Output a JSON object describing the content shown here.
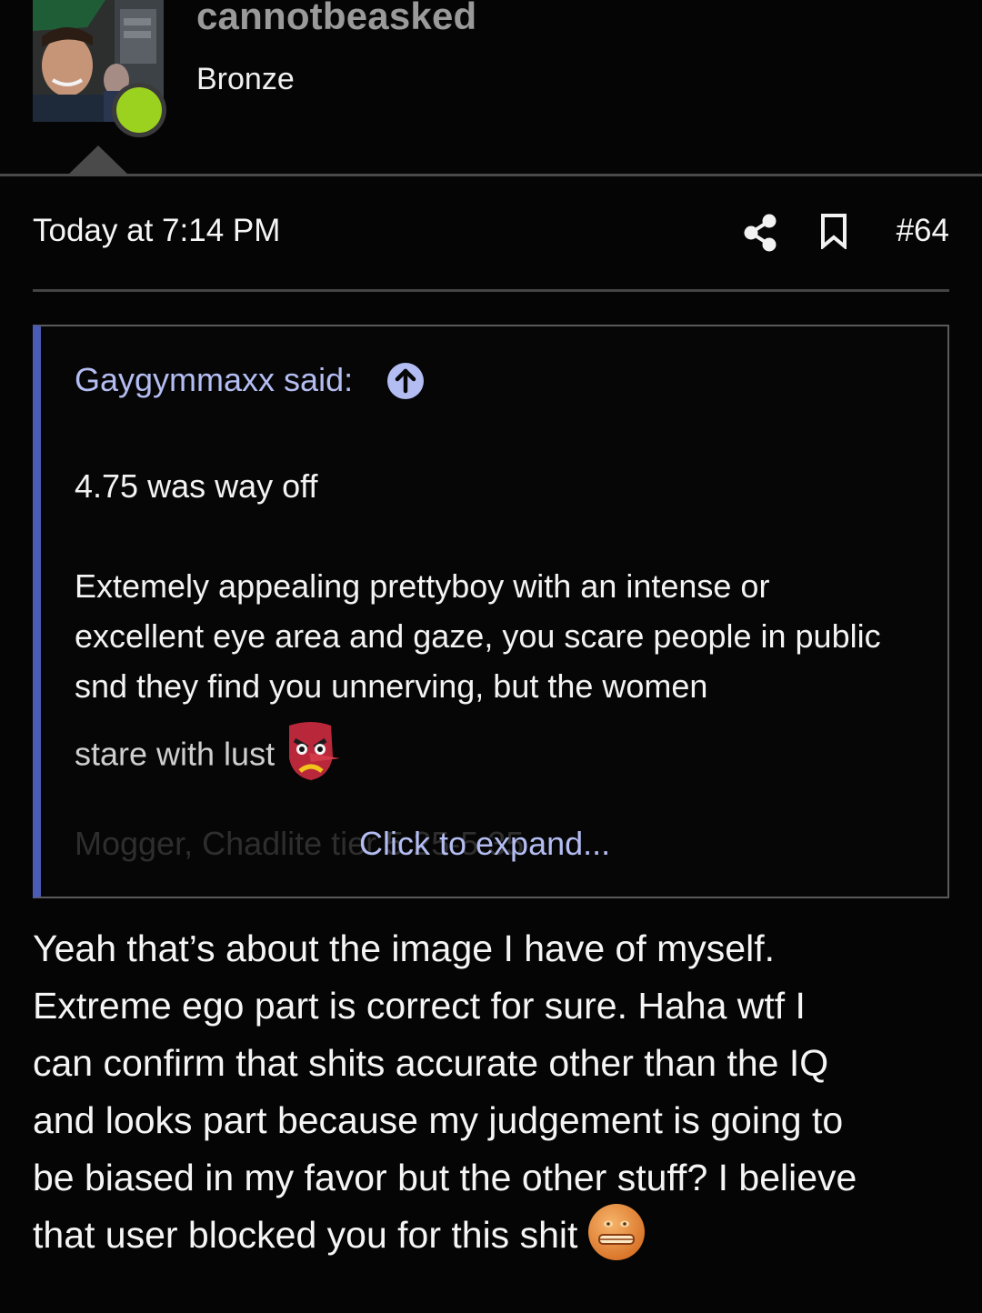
{
  "user": {
    "username": "cannotbeasked",
    "rank": "Bronze",
    "online": true,
    "online_color": "#9bd11f"
  },
  "post": {
    "date": "Today at 7:14 PM",
    "number": "#64",
    "icons": [
      "share-icon",
      "bookmark-icon"
    ]
  },
  "quote": {
    "author": "Gaygymmaxx said:",
    "line1": "4.75 was way off",
    "paragraph": "Extemely appealing prettyboy with an intense or excellent eye area and gaze, you scare people in public snd they find you unnerving, but the women",
    "faded_line": "stare with lust",
    "emoji": "angry-mask-emoji",
    "hidden_line": "Mogger, Chadlite tier 5.25-5.35",
    "expand_label": "Click to expand...",
    "accent_color": "#4b5cb6",
    "link_color": "#b4bdf2"
  },
  "reply": {
    "lines": [
      "Yeah that’s about the image I have of myself.",
      "Extreme ego part is correct for sure. Haha wtf I",
      "can confirm that shits accurate other than the IQ",
      "and looks part because my judgement is going to",
      "be biased in my favor but the other stuff? I believe"
    ],
    "last_line": "that user blocked you for this shit",
    "emoji": "grimace-emoji"
  }
}
